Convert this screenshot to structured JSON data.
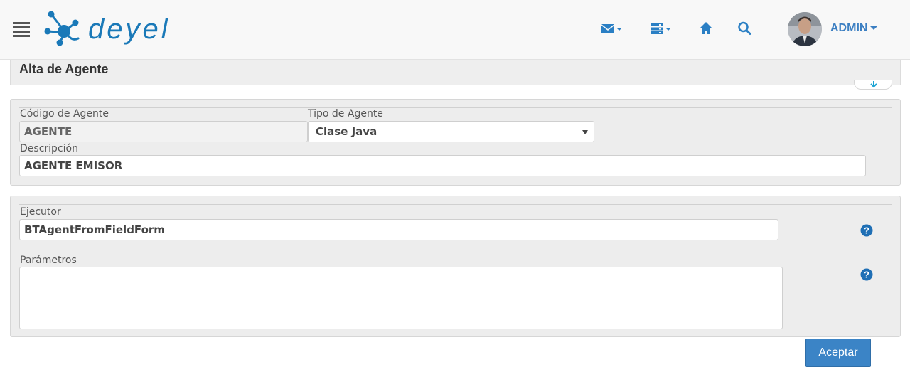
{
  "header": {
    "logo_text": "deyel",
    "user": {
      "name": "ADMIN"
    },
    "icons": [
      "menu-icon",
      "mail-icon",
      "list-icon",
      "home-icon",
      "search-icon",
      "user-avatar"
    ],
    "brand_color": "#1a79b8"
  },
  "page": {
    "title": "Alta de Agente"
  },
  "form": {
    "codigo": {
      "label": "Código de Agente",
      "value": "AGENTE"
    },
    "tipo": {
      "label": "Tipo de Agente",
      "value": "Clase Java",
      "options": [
        "Clase Java"
      ]
    },
    "descripcion": {
      "label": "Descripción",
      "value": "AGENTE EMISOR"
    },
    "ejecutor": {
      "label": "Ejecutor",
      "value": "BTAgentFromFieldForm"
    },
    "parametros": {
      "label": "Parámetros",
      "value": ""
    }
  },
  "actions": {
    "accept_label": "Aceptar"
  },
  "colors": {
    "accent": "#3b84c6",
    "help_icon": "#1f6fb5"
  }
}
